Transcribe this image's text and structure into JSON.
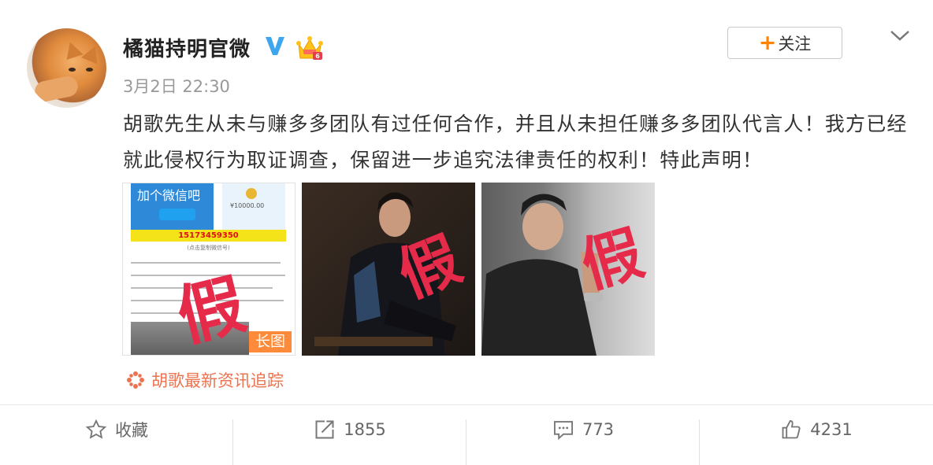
{
  "user": {
    "name": "橘猫持明官微",
    "verified_color": "#3da6ec"
  },
  "post": {
    "time": "3月2日 22:30",
    "text": "胡歌先生从未与赚多多团队有过任何合作，并且从未担任赚多多团队代言人！我方已经就此侵权行为取证调查，保留进一步追究法律责任的权利！特此声明！",
    "images": [
      {
        "headline": "加个微信吧",
        "amount": "¥10000.00",
        "phone": "15173459350",
        "copy_hint": "(点击复制微信号)",
        "stamp": "假",
        "badge": "长图"
      },
      {
        "stamp": "假"
      },
      {
        "stamp": "假"
      }
    ],
    "topic": "胡歌最新资讯追踪"
  },
  "follow_button": {
    "plus": "+",
    "label": "关注"
  },
  "actions": {
    "favorite": "收藏",
    "repost_count": "1855",
    "comment_count": "773",
    "like_count": "4231"
  },
  "colors": {
    "accent": "#ff8200",
    "topic": "#eb7350",
    "stamp": "#e62a4a",
    "badge": "#fd8b3a"
  }
}
